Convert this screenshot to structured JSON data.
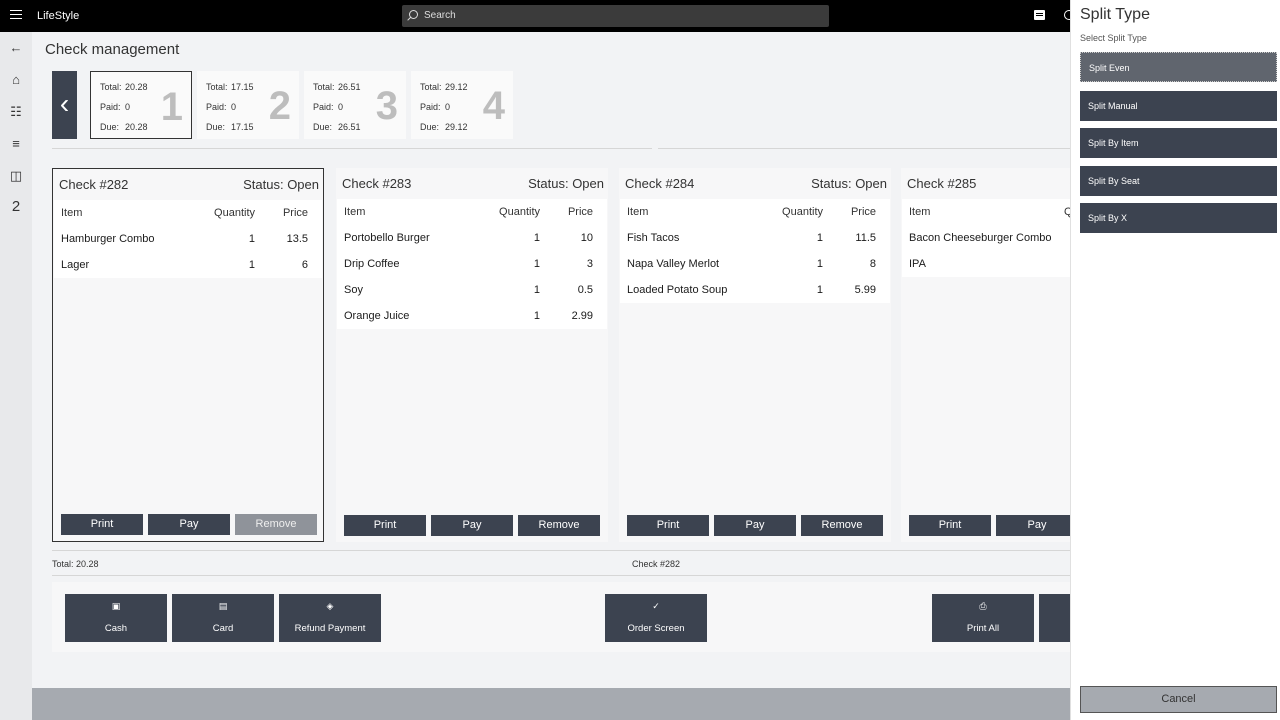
{
  "app": {
    "title": "LifeStyle",
    "search_placeholder": "Search"
  },
  "rail": {
    "badge_number": "2"
  },
  "page": {
    "title": "Check management"
  },
  "tiles": [
    {
      "total_label": "Total:",
      "total": "20.28",
      "paid_label": "Paid:",
      "paid": "0",
      "due_label": "Due:",
      "due": "20.28",
      "number": "1"
    },
    {
      "total_label": "Total:",
      "total": "17.15",
      "paid_label": "Paid:",
      "paid": "0",
      "due_label": "Due:",
      "due": "17.15",
      "number": "2"
    },
    {
      "total_label": "Total:",
      "total": "26.51",
      "paid_label": "Paid:",
      "paid": "0",
      "due_label": "Due:",
      "due": "26.51",
      "number": "3"
    },
    {
      "total_label": "Total:",
      "total": "29.12",
      "paid_label": "Paid:",
      "paid": "0",
      "due_label": "Due:",
      "due": "29.12",
      "number": "4"
    }
  ],
  "columns": {
    "item": "Item",
    "quantity": "Quantity",
    "price": "Price"
  },
  "checks": [
    {
      "title": "Check #282",
      "status": "Status: Open",
      "items": [
        {
          "name": "Hamburger Combo",
          "qty": "1",
          "price": "13.5"
        },
        {
          "name": "Lager",
          "qty": "1",
          "price": "6"
        }
      ],
      "actions": {
        "print": "Print",
        "pay": "Pay",
        "remove": "Remove"
      }
    },
    {
      "title": "Check #283",
      "status": "Status: Open",
      "items": [
        {
          "name": "Portobello Burger",
          "qty": "1",
          "price": "10"
        },
        {
          "name": "Drip Coffee",
          "qty": "1",
          "price": "3"
        },
        {
          "name": "Soy",
          "qty": "1",
          "price": "0.5"
        },
        {
          "name": "Orange Juice",
          "qty": "1",
          "price": "2.99"
        }
      ],
      "actions": {
        "print": "Print",
        "pay": "Pay",
        "remove": "Remove"
      }
    },
    {
      "title": "Check #284",
      "status": "Status: Open",
      "items": [
        {
          "name": "Fish Tacos",
          "qty": "1",
          "price": "11.5"
        },
        {
          "name": "Napa Valley Merlot",
          "qty": "1",
          "price": "8"
        },
        {
          "name": "Loaded Potato Soup",
          "qty": "1",
          "price": "5.99"
        }
      ],
      "actions": {
        "print": "Print",
        "pay": "Pay",
        "remove": "Remove"
      }
    },
    {
      "title": "Check #285",
      "status": "",
      "items": [
        {
          "name": "Bacon Cheeseburger Combo",
          "qty": "",
          "price": ""
        },
        {
          "name": "IPA",
          "qty": "",
          "price": ""
        }
      ],
      "actions": {
        "print": "Print",
        "pay": "Pay",
        "remove": ""
      }
    }
  ],
  "footer": {
    "total": "Total: 20.28",
    "check": "Check #282"
  },
  "bottom_buttons": {
    "cash": "Cash",
    "card": "Card",
    "refund": "Refund Payment",
    "order_screen": "Order Screen",
    "print_all": "Print All"
  },
  "split_panel": {
    "title": "Split Type",
    "subtitle": "Select Split Type",
    "options": [
      "Split Even",
      "Split Manual",
      "Split By Item",
      "Split By Seat",
      "Split By X"
    ],
    "cancel": "Cancel"
  }
}
